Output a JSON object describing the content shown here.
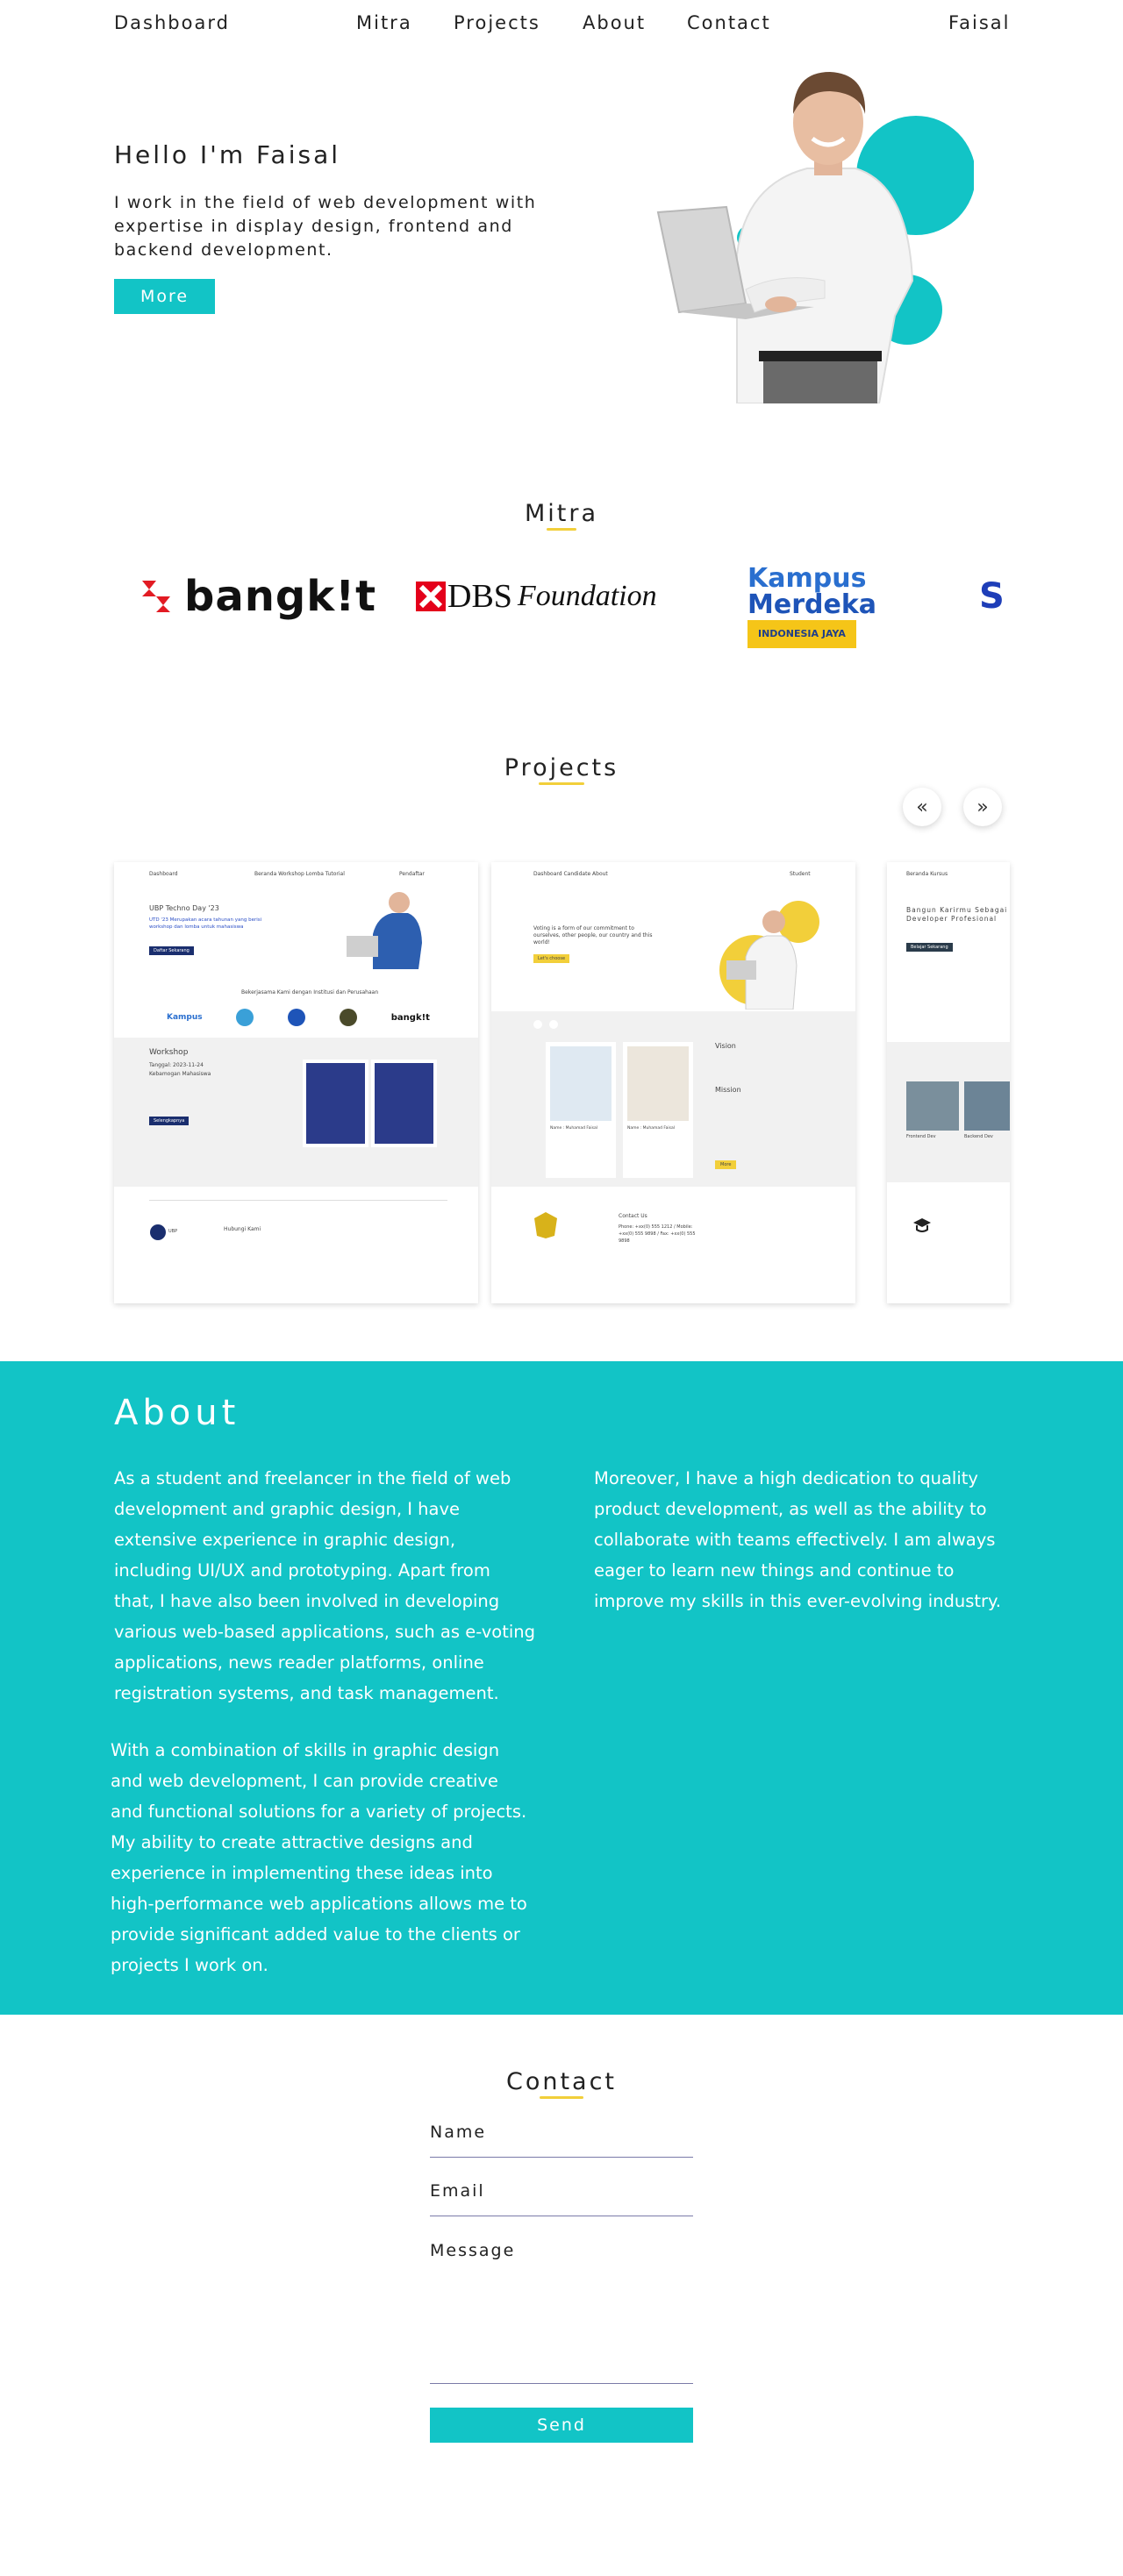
{
  "nav": {
    "brand": "Dashboard",
    "links": [
      "Mitra",
      "Projects",
      "About",
      "Contact"
    ],
    "user": "Faisal"
  },
  "hero": {
    "title": "Hello I'm Faisal",
    "description": "I work in the field of web development with expertise in display design, frontend and backend development.",
    "button": "More"
  },
  "mitra": {
    "title": "Mitra",
    "logos": [
      "bangkit",
      "DBS Foundation",
      "Kampus Merdeka",
      "S"
    ],
    "bangkit_text": "bangk!t",
    "dbs_text": "DBS",
    "dbs_script": "Foundation",
    "km_line1": "Kampus",
    "km_line2": "Merdeka",
    "km_line3": "INDONESIA JAYA",
    "partial": "S"
  },
  "projects": {
    "title": "Projects",
    "prev": "«",
    "next": "»",
    "card1": {
      "nav_brand": "Dashboard",
      "nav_links": "Beranda   Workshop   Lomba   Tutorial",
      "nav_right": "Pendaftar",
      "hero_title": "UBP Techno Day '23",
      "hero_desc": "UTD '23 Merupakan acara tahunan yang berisi workshop dan lomba untuk mahasiswa",
      "hero_btn": "Daftar Sekarang",
      "partners_title": "Bekerjasama Kami dengan Institusi dan Perusahaan",
      "workshop_title": "Workshop",
      "workshop_date": "Tanggal: 2023-11-24",
      "workshop_place": "Kebamogan Mahasiswa",
      "workshop_btn": "Selengkapnya",
      "footer_title": "Hubungi Kami",
      "footer_logo": "UBP"
    },
    "card2": {
      "nav_links": "Dashboard   Candidate   About",
      "nav_right": "Student",
      "hero_text": "Voting is a form of our commitment to ourselves, other people, our country and this world!",
      "hero_btn": "Let's choose",
      "vision": "Vision",
      "mission": "Mission",
      "cand1": "Name : Muhamad Faisal",
      "cand2": "Name : Muhamad Faisal",
      "more_btn": "More",
      "contact_title": "Contact Us",
      "contact_lines": "Phone: +xx(0) 555 1212 / Mobile: +xx(0) 555 9898 / Fax: +xx(0) 555 9898"
    },
    "card3": {
      "nav_links": "Beranda   Kursus",
      "hero_title": "Bangun Karirmu Sebagai Developer Profesional",
      "hero_btn": "Belajar Sekarang",
      "c1": "Frontend Dev",
      "c2": "Backend Dev"
    }
  },
  "about": {
    "title": "About",
    "p1": "As a student and freelancer in the field of web development and graphic design, I have extensive experience in graphic design, including UI/UX and prototyping. Apart from that, I have also been involved in developing various web-based applications, such as e-voting applications, news reader platforms, online registration systems, and task management.",
    "p2": "Moreover, I have a high dedication to quality product development, as well as the ability to collaborate with teams effectively. I am always eager to learn new things and continue to improve my skills in this ever-evolving industry.",
    "p3": "With a combination of skills in graphic design and web development, I can provide creative and functional solutions for a variety of projects. My ability to create attractive designs and experience in implementing these ideas into high-performance web applications allows me to provide significant added value to the clients or projects I work on."
  },
  "contact": {
    "title": "Contact",
    "name_label": "Name",
    "email_label": "Email",
    "message_label": "Message",
    "send": "Send"
  },
  "colors": {
    "accent": "#12c4c6",
    "underline": "#f2cf3a",
    "text": "#222222"
  }
}
